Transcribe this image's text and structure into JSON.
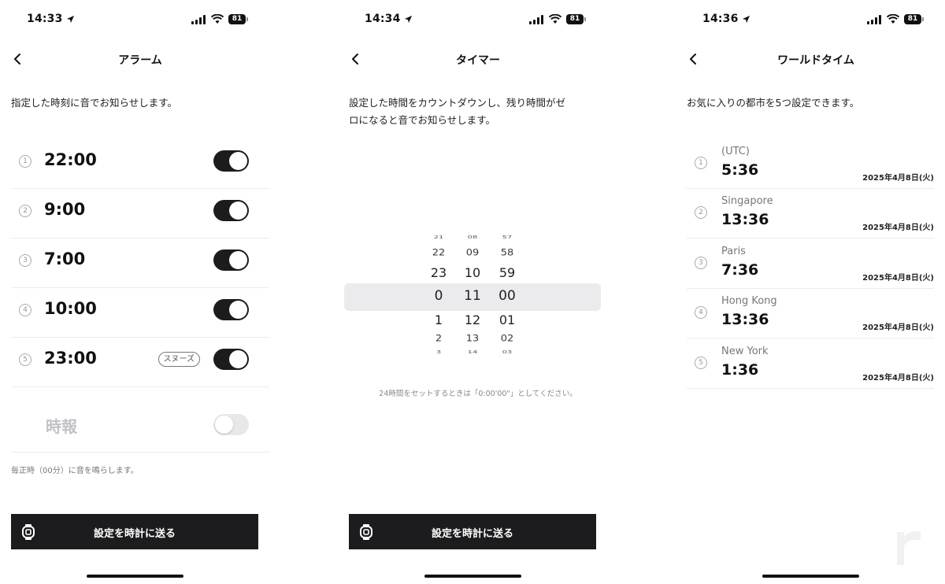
{
  "screens": [
    {
      "status": {
        "time": "14:33",
        "battery": "81"
      },
      "title": "アラーム",
      "description": "指定した時刻に音でお知らせします。",
      "alarms": [
        {
          "index": "1",
          "time": "22:00",
          "on": true
        },
        {
          "index": "2",
          "time": "9:00",
          "on": true
        },
        {
          "index": "3",
          "time": "7:00",
          "on": true
        },
        {
          "index": "4",
          "time": "10:00",
          "on": true
        },
        {
          "index": "5",
          "time": "23:00",
          "on": true,
          "badge": "スヌーズ"
        }
      ],
      "chime": {
        "label": "時報",
        "on": false
      },
      "note": "毎正時（00分）に音を鳴らします。",
      "send_label": "設定を時計に送る"
    },
    {
      "status": {
        "time": "14:34",
        "battery": "81"
      },
      "title": "タイマー",
      "description_lines": [
        "設定した時間をカウントダウンし、残り時間がゼ",
        "ロになると音でお知らせします。"
      ],
      "picker": {
        "hours": [
          "21",
          "22",
          "23",
          "0",
          "1",
          "2",
          "3"
        ],
        "minutes": [
          "08",
          "09",
          "10",
          "11",
          "12",
          "13",
          "14"
        ],
        "seconds": [
          "57",
          "58",
          "59",
          "00",
          "01",
          "02",
          "03"
        ]
      },
      "note": "24時間をセットするときは「0:00'00\"」としてください。",
      "send_label": "設定を時計に送る"
    },
    {
      "status": {
        "time": "14:36",
        "battery": "81"
      },
      "title": "ワールドタイム",
      "description": "お気に入りの都市を5つ設定できます。",
      "cities": [
        {
          "index": "1",
          "name": "(UTC)",
          "time": "5:36",
          "date": "2025年4月8日(火)"
        },
        {
          "index": "2",
          "name": "Singapore",
          "time": "13:36",
          "date": "2025年4月8日(火)"
        },
        {
          "index": "3",
          "name": "Paris",
          "time": "7:36",
          "date": "2025年4月8日(火)"
        },
        {
          "index": "4",
          "name": "Hong Kong",
          "time": "13:36",
          "date": "2025年4月8日(火)"
        },
        {
          "index": "5",
          "name": "New York",
          "time": "1:36",
          "date": "2025年4月8日(火)"
        }
      ]
    }
  ],
  "colors": {
    "dark": "#1c1c1e",
    "toggle_off": "#e8e8ea",
    "divider": "#ececec",
    "muted": "#777777"
  },
  "icons": [
    "location-arrow-icon",
    "signal-icon",
    "wifi-icon",
    "battery-icon",
    "chevron-left-icon",
    "watch-icon",
    "circled-number-icon",
    "watermark-r-logo"
  ]
}
